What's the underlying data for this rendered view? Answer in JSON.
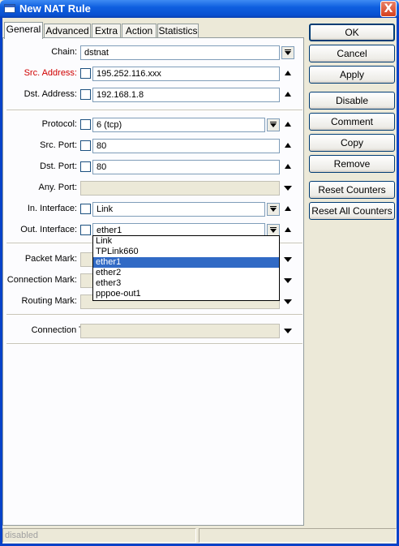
{
  "window": {
    "title": "New NAT Rule",
    "close": "X"
  },
  "tabs": [
    "General",
    "Advanced",
    "Extra",
    "Action",
    "Statistics"
  ],
  "fields": {
    "chain": {
      "label": "Chain:",
      "value": "dstnat"
    },
    "src_address": {
      "label": "Src. Address:",
      "value": "195.252.116.xxx"
    },
    "dst_address": {
      "label": "Dst. Address:",
      "value": "192.168.1.8"
    },
    "protocol": {
      "label": "Protocol:",
      "value": "6 (tcp)"
    },
    "src_port": {
      "label": "Src. Port:",
      "value": "80"
    },
    "dst_port": {
      "label": "Dst. Port:",
      "value": "80"
    },
    "any_port": {
      "label": "Any. Port:",
      "value": ""
    },
    "in_interface": {
      "label": "In. Interface:",
      "value": "Link"
    },
    "out_interface": {
      "label": "Out. Interface:",
      "value": "ether1"
    },
    "packet_mark": {
      "label": "Packet Mark:",
      "value": ""
    },
    "connection_mark": {
      "label": "Connection Mark:",
      "value": ""
    },
    "routing_mark": {
      "label": "Routing Mark:",
      "value": ""
    },
    "connection_type": {
      "label": "Connection Type:",
      "value": ""
    }
  },
  "dropdown": {
    "options": [
      "Link",
      "TPLink660",
      "ether1",
      "ether2",
      "ether3",
      "pppoe-out1"
    ],
    "selected": "ether1"
  },
  "buttons": [
    "OK",
    "Cancel",
    "Apply",
    "Disable",
    "Comment",
    "Copy",
    "Remove",
    "Reset Counters",
    "Reset All Counters"
  ],
  "status": {
    "text": "disabled"
  },
  "colors": {
    "title_bar": "#0850d0",
    "required_label": "#d00000",
    "selection": "#316ac5"
  }
}
